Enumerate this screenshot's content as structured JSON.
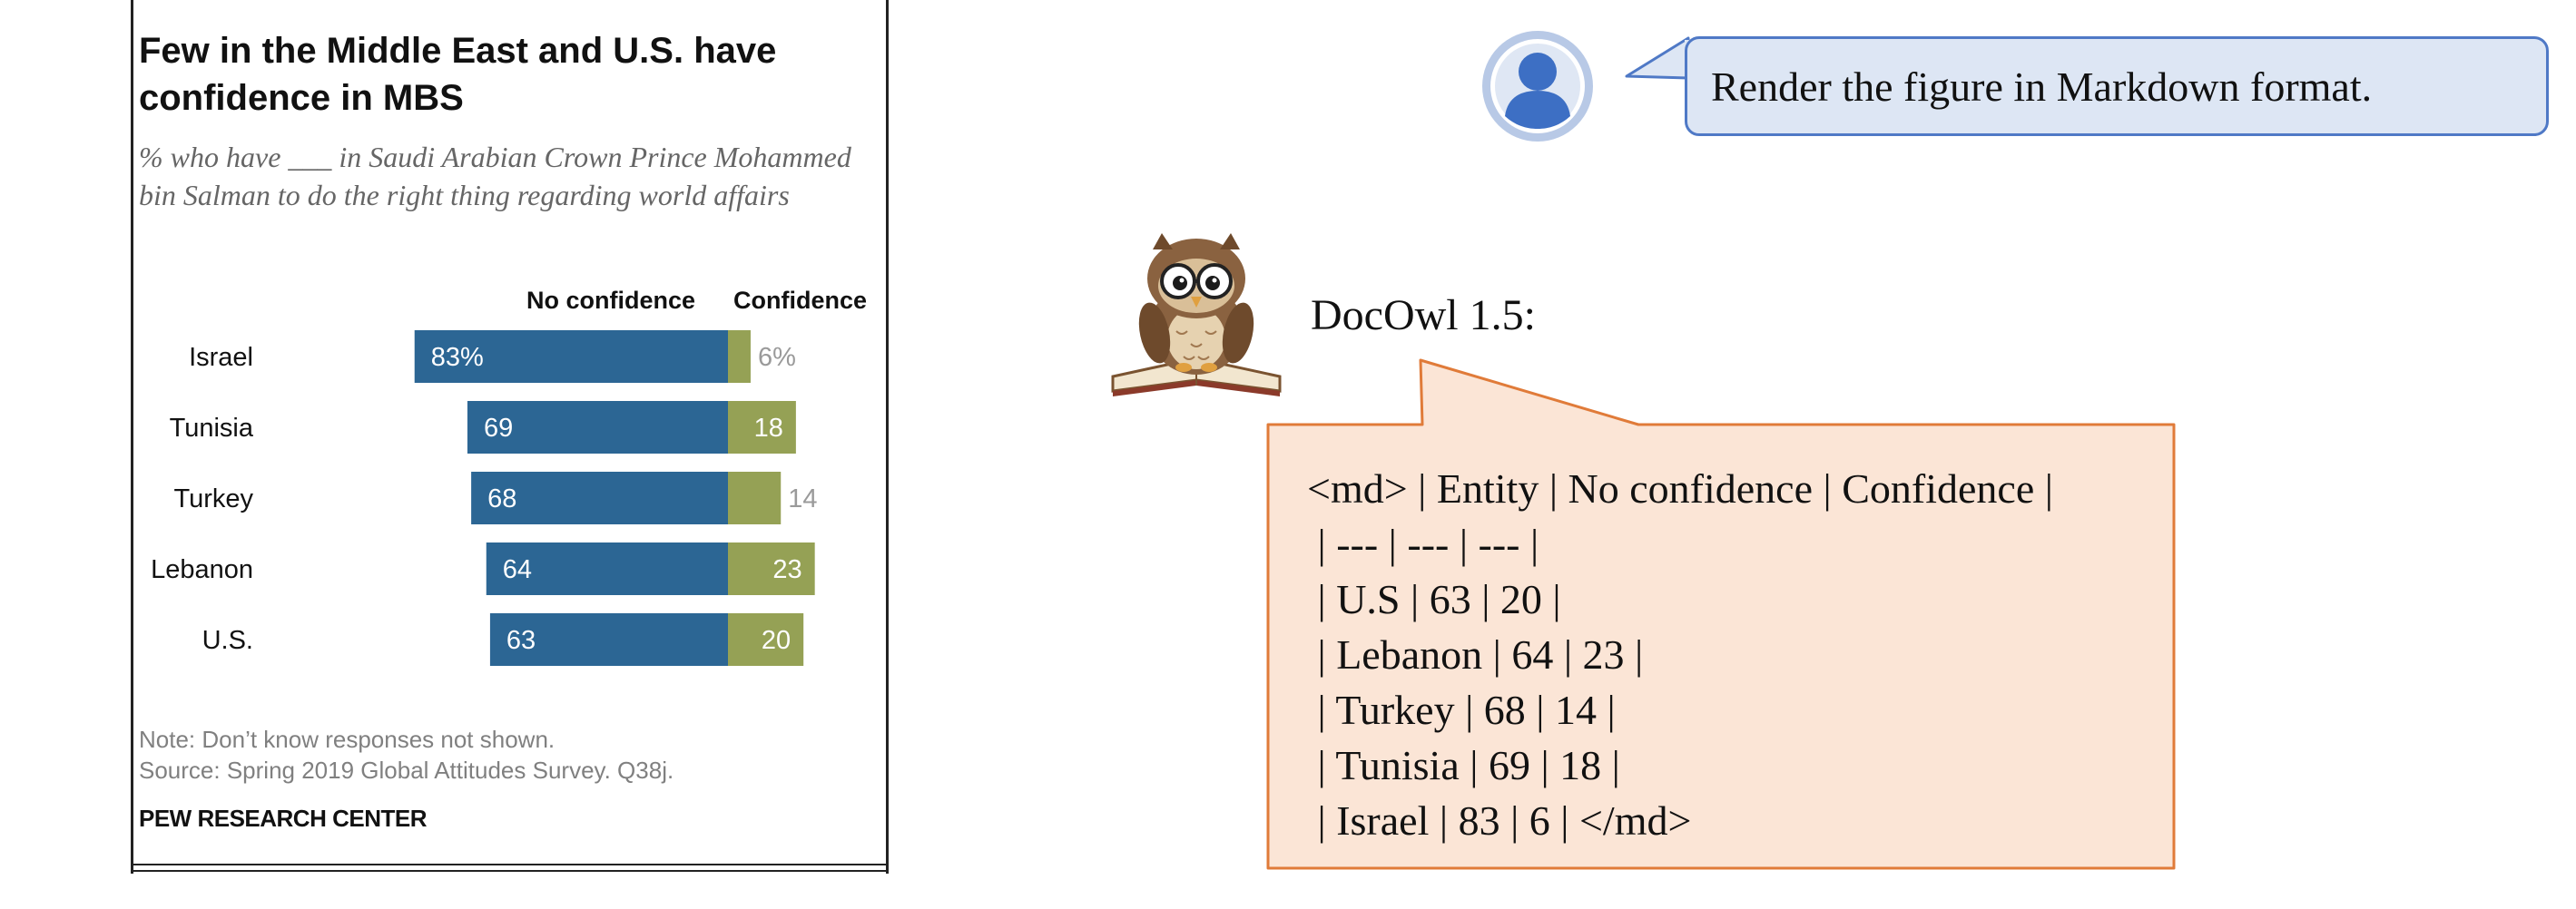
{
  "chart_card": {
    "title": "Few in the Middle East and U.S. have confidence in MBS",
    "subtitle": "% who have ___ in Saudi Arabian Crown Prince Mohammed bin Salman to do the right thing regarding world affairs",
    "note": "Note: Don’t know responses not shown.",
    "source": "Source: Spring 2019 Global Attitudes Survey. Q38j.",
    "brand": "PEW RESEARCH CENTER"
  },
  "chart_data": {
    "type": "bar",
    "orientation": "horizontal-diverging",
    "categories": [
      "Israel",
      "Tunisia",
      "Turkey",
      "Lebanon",
      "U.S."
    ],
    "series": [
      {
        "name": "No confidence",
        "values": [
          83,
          69,
          68,
          64,
          63
        ],
        "labels": [
          "83%",
          "69",
          "68",
          "64",
          "63"
        ],
        "color": "#2c6694"
      },
      {
        "name": "Confidence",
        "values": [
          6,
          18,
          14,
          23,
          20
        ],
        "labels": [
          "6%",
          "18",
          "14",
          "23",
          "20"
        ],
        "color": "#95a155"
      }
    ],
    "confidence_small_label_color": "#9a9a9a",
    "grid": false
  },
  "user_message": {
    "text": "Render the figure in Markdown format.",
    "avatar_icon": "user-icon"
  },
  "assistant_message": {
    "name": "DocOwl 1.5:",
    "avatar_icon": "owl-icon",
    "lines": [
      "<md> | Entity | No confidence | Confidence |",
      " | --- | --- | --- |",
      " | U.S | 63 | 20 |",
      " | Lebanon | 64 | 23 |",
      " | Turkey | 68 | 14 |",
      " | Tunisia | 69 | 18 |",
      " | Israel | 83 | 6 | </md>"
    ]
  },
  "colors": {
    "user_bubble_fill": "#dde6f4",
    "user_bubble_border": "#4f79c6",
    "assistant_bubble_fill": "#fbe5d6",
    "assistant_bubble_border": "#e07b39"
  }
}
